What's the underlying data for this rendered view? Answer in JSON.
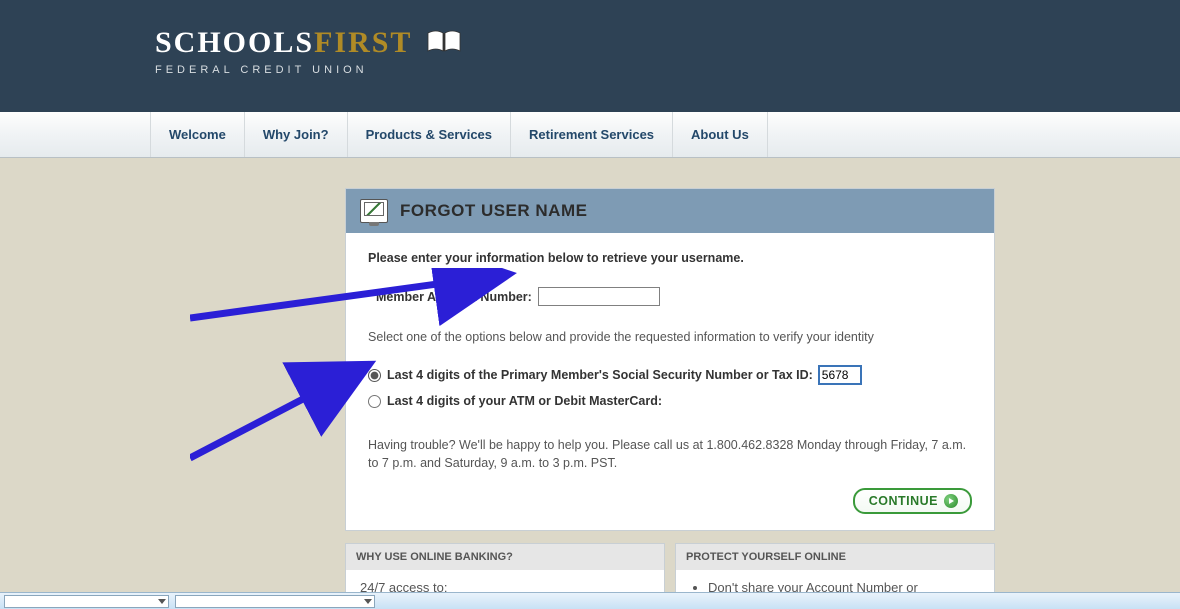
{
  "logo": {
    "word1": "SCHOOLS",
    "word2": "FIRST",
    "subtitle": "FEDERAL CREDIT UNION"
  },
  "nav": {
    "items": [
      "Welcome",
      "Why Join?",
      "Products & Services",
      "Retirement Services",
      "About Us"
    ]
  },
  "panel": {
    "title": "FORGOT USER NAME",
    "instruction1": "Please enter your information below to retrieve your username.",
    "account_label": "Member Account Number:",
    "account_value": "",
    "instruction2": "Select one of the options below and provide the requested information to verify your identity",
    "option_ssn_label": "Last 4 digits of the Primary Member's Social Security Number or Tax ID:",
    "option_ssn_value": "5678",
    "option_atm_label": "Last 4 digits of your ATM or Debit MasterCard:",
    "help_text": "Having trouble? We'll be happy to help you. Please call us at 1.800.462.8328 Monday through Friday, 7 a.m. to 7 p.m. and Saturday, 9 a.m. to 3 p.m. PST.",
    "continue_label": "CONTINUE"
  },
  "sub1": {
    "title": "WHY USE ONLINE BANKING?",
    "line1": "24/7 access to:"
  },
  "sub2": {
    "title": "PROTECT YOURSELF ONLINE",
    "bullet1": "Don't share your Account Number or"
  }
}
